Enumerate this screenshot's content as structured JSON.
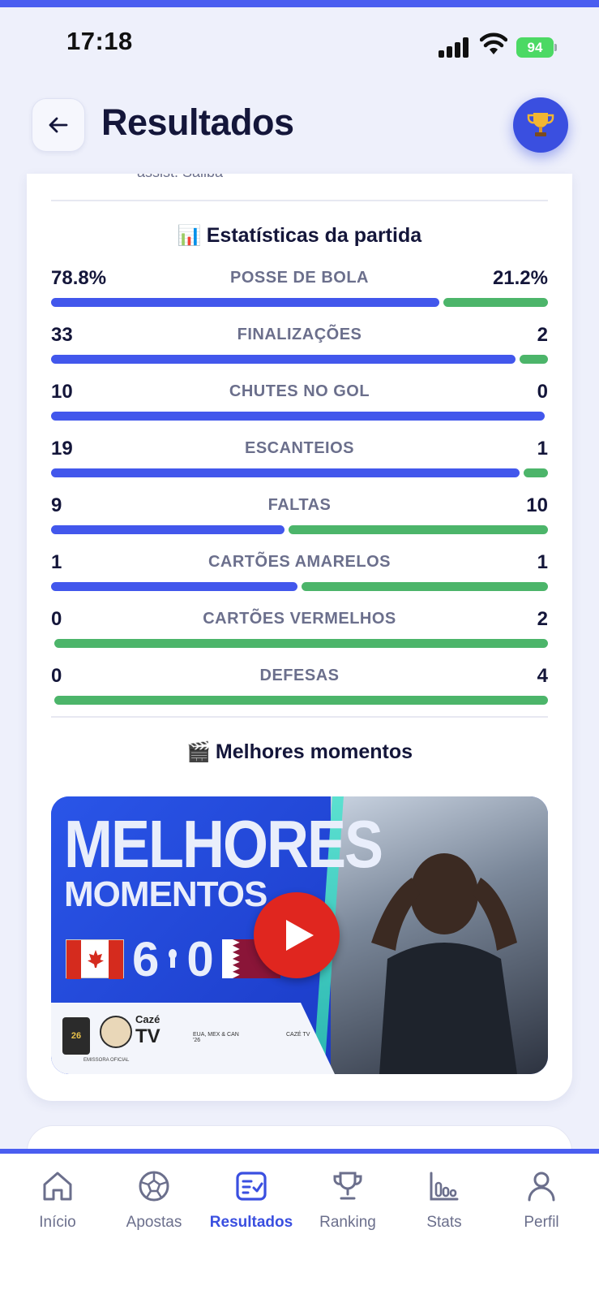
{
  "status_bar": {
    "time": "17:18",
    "battery": "94"
  },
  "header": {
    "title": "Resultados"
  },
  "card": {
    "assist_text": "assist: Saliba",
    "stats_title": "Estatísticas da partida",
    "stats_emoji": "📊",
    "stats": [
      {
        "label": "POSSE DE BOLA",
        "home": "78.8%",
        "away": "21.2%",
        "home_value": 78.8,
        "away_value": 21.2
      },
      {
        "label": "FINALIZAÇÕES",
        "home": "33",
        "away": "2",
        "home_value": 33,
        "away_value": 2
      },
      {
        "label": "CHUTES NO GOL",
        "home": "10",
        "away": "0",
        "home_value": 10,
        "away_value": 0
      },
      {
        "label": "ESCANTEIOS",
        "home": "19",
        "away": "1",
        "home_value": 19,
        "away_value": 1
      },
      {
        "label": "FALTAS",
        "home": "9",
        "away": "10",
        "home_value": 9,
        "away_value": 10
      },
      {
        "label": "CARTÕES AMARELOS",
        "home": "1",
        "away": "1",
        "home_value": 1,
        "away_value": 1
      },
      {
        "label": "CARTÕES VERMELHOS",
        "home": "0",
        "away": "2",
        "home_value": 0,
        "away_value": 2
      },
      {
        "label": "DEFESAS",
        "home": "0",
        "away": "4",
        "home_value": 0,
        "away_value": 4
      }
    ],
    "highlights_title": "Melhores momentos",
    "highlights_emoji": "🎬",
    "video": {
      "title_line1": "MELHORES",
      "title_line2": "MOMENTOS",
      "score_home": "6",
      "score_away": "0",
      "brand_caze": "Cazé",
      "brand_tv": "TV",
      "small_left": "EUA, MEX & CAN '26",
      "small_right": "CAZÉ TV",
      "official": "EMISSORA OFICIAL",
      "fifa_badge": "26"
    }
  },
  "tabbar": {
    "items": [
      {
        "label": "Início",
        "icon": "home-icon"
      },
      {
        "label": "Apostas",
        "icon": "soccer-ball-icon"
      },
      {
        "label": "Resultados",
        "icon": "results-icon",
        "active": true
      },
      {
        "label": "Ranking",
        "icon": "trophy-icon"
      },
      {
        "label": "Stats",
        "icon": "bar-chart-icon"
      },
      {
        "label": "Perfil",
        "icon": "user-icon"
      }
    ]
  },
  "colors": {
    "accent": "#3a4fe0",
    "home_bar": "#4257ec",
    "away_bar": "#4cb56a",
    "play": "#e0261f"
  }
}
